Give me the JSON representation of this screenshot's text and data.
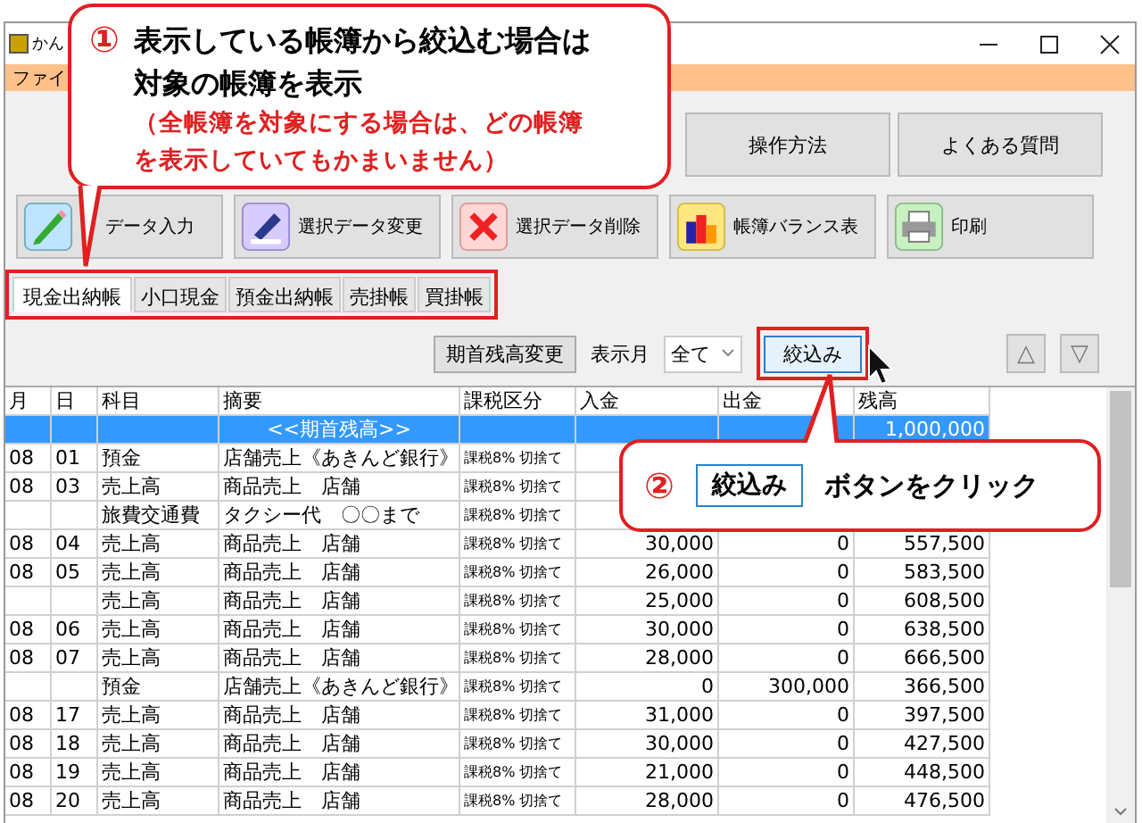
{
  "window": {
    "title": "かん"
  },
  "menu": [
    "ファイ"
  ],
  "top_buttons": [
    "操作方法",
    "よくある質問"
  ],
  "toolbar": [
    "データ入力",
    "選択データ変更",
    "選択データ削除",
    "帳簿バランス表",
    "印刷"
  ],
  "tabs": [
    {
      "label": "現金出納帳",
      "selected": true
    },
    {
      "label": "小口現金",
      "selected": false
    },
    {
      "label": "預金出納帳",
      "selected": false
    },
    {
      "label": "売掛帳",
      "selected": false
    },
    {
      "label": "買掛帳",
      "selected": false
    }
  ],
  "filter": {
    "opening_button": "期首残高変更",
    "month_label": "表示月",
    "month_value": "全て",
    "filter_button": "絞込み",
    "up": "△",
    "down": "▽"
  },
  "table": {
    "columns": [
      "月",
      "日",
      "科目",
      "摘要",
      "課税区分",
      "入金",
      "出金",
      "残高"
    ],
    "rows": [
      {
        "kind": "opening",
        "memo": "<<期首残高>>",
        "balance": "1,000,000"
      },
      {
        "kind": "entry",
        "month": "08",
        "day": "01",
        "account": "預金",
        "memo": "店舗売上《あきんど銀行》",
        "tax": "課税8% 切捨て"
      },
      {
        "kind": "entry",
        "month": "08",
        "day": "03",
        "account": "売上高",
        "memo": "商品売上　店舗",
        "tax": "課税8% 切捨て"
      },
      {
        "kind": "entry",
        "account": "旅費交通費",
        "memo": "タクシー代　〇〇まで",
        "tax": "課税8% 切捨て"
      },
      {
        "kind": "entry",
        "month": "08",
        "day": "04",
        "account": "売上高",
        "memo": "商品売上　店舗",
        "tax": "課税8% 切捨て",
        "deposit": "30,000",
        "withdrawal": "0",
        "balance": "557,500"
      },
      {
        "kind": "entry",
        "month": "08",
        "day": "05",
        "account": "売上高",
        "memo": "商品売上　店舗",
        "tax": "課税8% 切捨て",
        "deposit": "26,000",
        "withdrawal": "0",
        "balance": "583,500"
      },
      {
        "kind": "entry",
        "account": "売上高",
        "memo": "商品売上　店舗",
        "tax": "課税8% 切捨て",
        "deposit": "25,000",
        "withdrawal": "0",
        "balance": "608,500"
      },
      {
        "kind": "entry",
        "month": "08",
        "day": "06",
        "account": "売上高",
        "memo": "商品売上　店舗",
        "tax": "課税8% 切捨て",
        "deposit": "30,000",
        "withdrawal": "0",
        "balance": "638,500"
      },
      {
        "kind": "entry",
        "month": "08",
        "day": "07",
        "account": "売上高",
        "memo": "商品売上　店舗",
        "tax": "課税8% 切捨て",
        "deposit": "28,000",
        "withdrawal": "0",
        "balance": "666,500"
      },
      {
        "kind": "entry",
        "account": "預金",
        "memo": "店舗売上《あきんど銀行》",
        "tax": "課税8% 切捨て",
        "deposit": "0",
        "withdrawal": "300,000",
        "balance": "366,500"
      },
      {
        "kind": "entry",
        "month": "08",
        "day": "17",
        "account": "売上高",
        "memo": "商品売上　店舗",
        "tax": "課税8% 切捨て",
        "deposit": "31,000",
        "withdrawal": "0",
        "balance": "397,500"
      },
      {
        "kind": "entry",
        "month": "08",
        "day": "18",
        "account": "売上高",
        "memo": "商品売上　店舗",
        "tax": "課税8% 切捨て",
        "deposit": "30,000",
        "withdrawal": "0",
        "balance": "427,500"
      },
      {
        "kind": "entry",
        "month": "08",
        "day": "19",
        "account": "売上高",
        "memo": "商品売上　店舗",
        "tax": "課税8% 切捨て",
        "deposit": "21,000",
        "withdrawal": "0",
        "balance": "448,500"
      },
      {
        "kind": "entry",
        "month": "08",
        "day": "20",
        "account": "売上高",
        "memo": "商品売上　店舗",
        "tax": "課税8% 切捨て",
        "deposit": "28,000",
        "withdrawal": "0",
        "balance": "476,500"
      }
    ]
  },
  "callouts": [
    {
      "number": "①",
      "title": "表示している帳簿から絞込む場合は対象の帳簿を表示",
      "note": "（全帳簿を対象にする場合は、どの帳簿を表示していてもかまいません）"
    },
    {
      "number": "②",
      "button": "絞込み",
      "text": "ボタンをクリック"
    }
  ]
}
